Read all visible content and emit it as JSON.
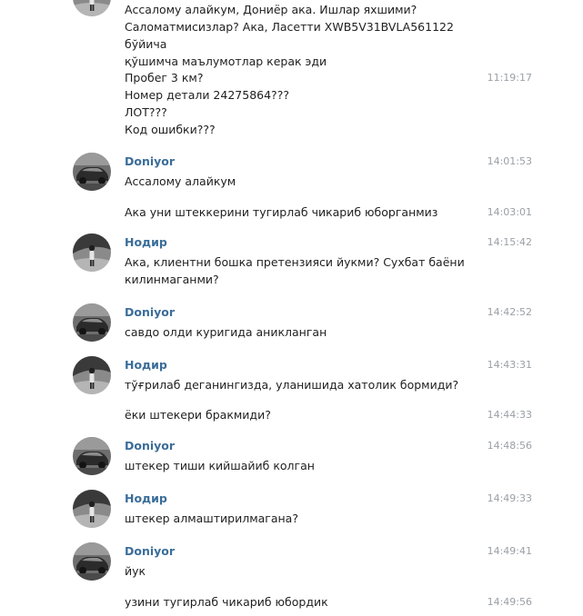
{
  "chat": {
    "groups": [
      {
        "sender": "nodir",
        "author": "",
        "messages": [
          {
            "text": "Ассалому алайкум, Дониёр ака. Ишлар яхшими?\nСаломатмисизлар? Ака, Ласетти XWB5V31BVLA561122 бўйича\nқўшимча маълумотлар керак эди",
            "time": ""
          },
          {
            "text": "Пробег 3 км?\nНомер детали 24275864???\nЛОТ???\nКод ошибки???",
            "time": "11:19:17"
          }
        ]
      },
      {
        "sender": "doniyor",
        "author": "Doniyor",
        "messages": [
          {
            "text": "Ассалому алайкум",
            "time": "14:01:53"
          },
          {
            "text": "Ака уни штеккерини тугирлаб чикариб юборганмиз",
            "time": "14:03:01"
          }
        ]
      },
      {
        "sender": "nodir",
        "author": "Нодир",
        "messages": [
          {
            "text": "Ака, клиентни бошка претензияси йукми? Сухбат баёни\nкилинмаганми?",
            "time": "14:15:42"
          }
        ]
      },
      {
        "sender": "doniyor",
        "author": "Doniyor",
        "messages": [
          {
            "text": "савдо олди куригида аникланган",
            "time": "14:42:52"
          }
        ]
      },
      {
        "sender": "nodir",
        "author": "Нодир",
        "messages": [
          {
            "text": "тўғрилаб деганингизда, уланишида хатолик бормиди?",
            "time": "14:43:31"
          },
          {
            "text": "ёки штекери бракмиди?",
            "time": "14:44:33"
          }
        ]
      },
      {
        "sender": "doniyor",
        "author": "Doniyor",
        "messages": [
          {
            "text": "штекер тиши кийшайиб колган",
            "time": "14:48:56"
          }
        ]
      },
      {
        "sender": "nodir",
        "author": "Нодир",
        "messages": [
          {
            "text": "штекер алмаштирилмагана?",
            "time": "14:49:33"
          }
        ]
      },
      {
        "sender": "doniyor",
        "author": "Doniyor",
        "messages": [
          {
            "text": "йук",
            "time": "14:49:41"
          },
          {
            "text": "узини тугирлаб чикариб юбордик",
            "time": "14:49:56"
          }
        ]
      }
    ]
  }
}
